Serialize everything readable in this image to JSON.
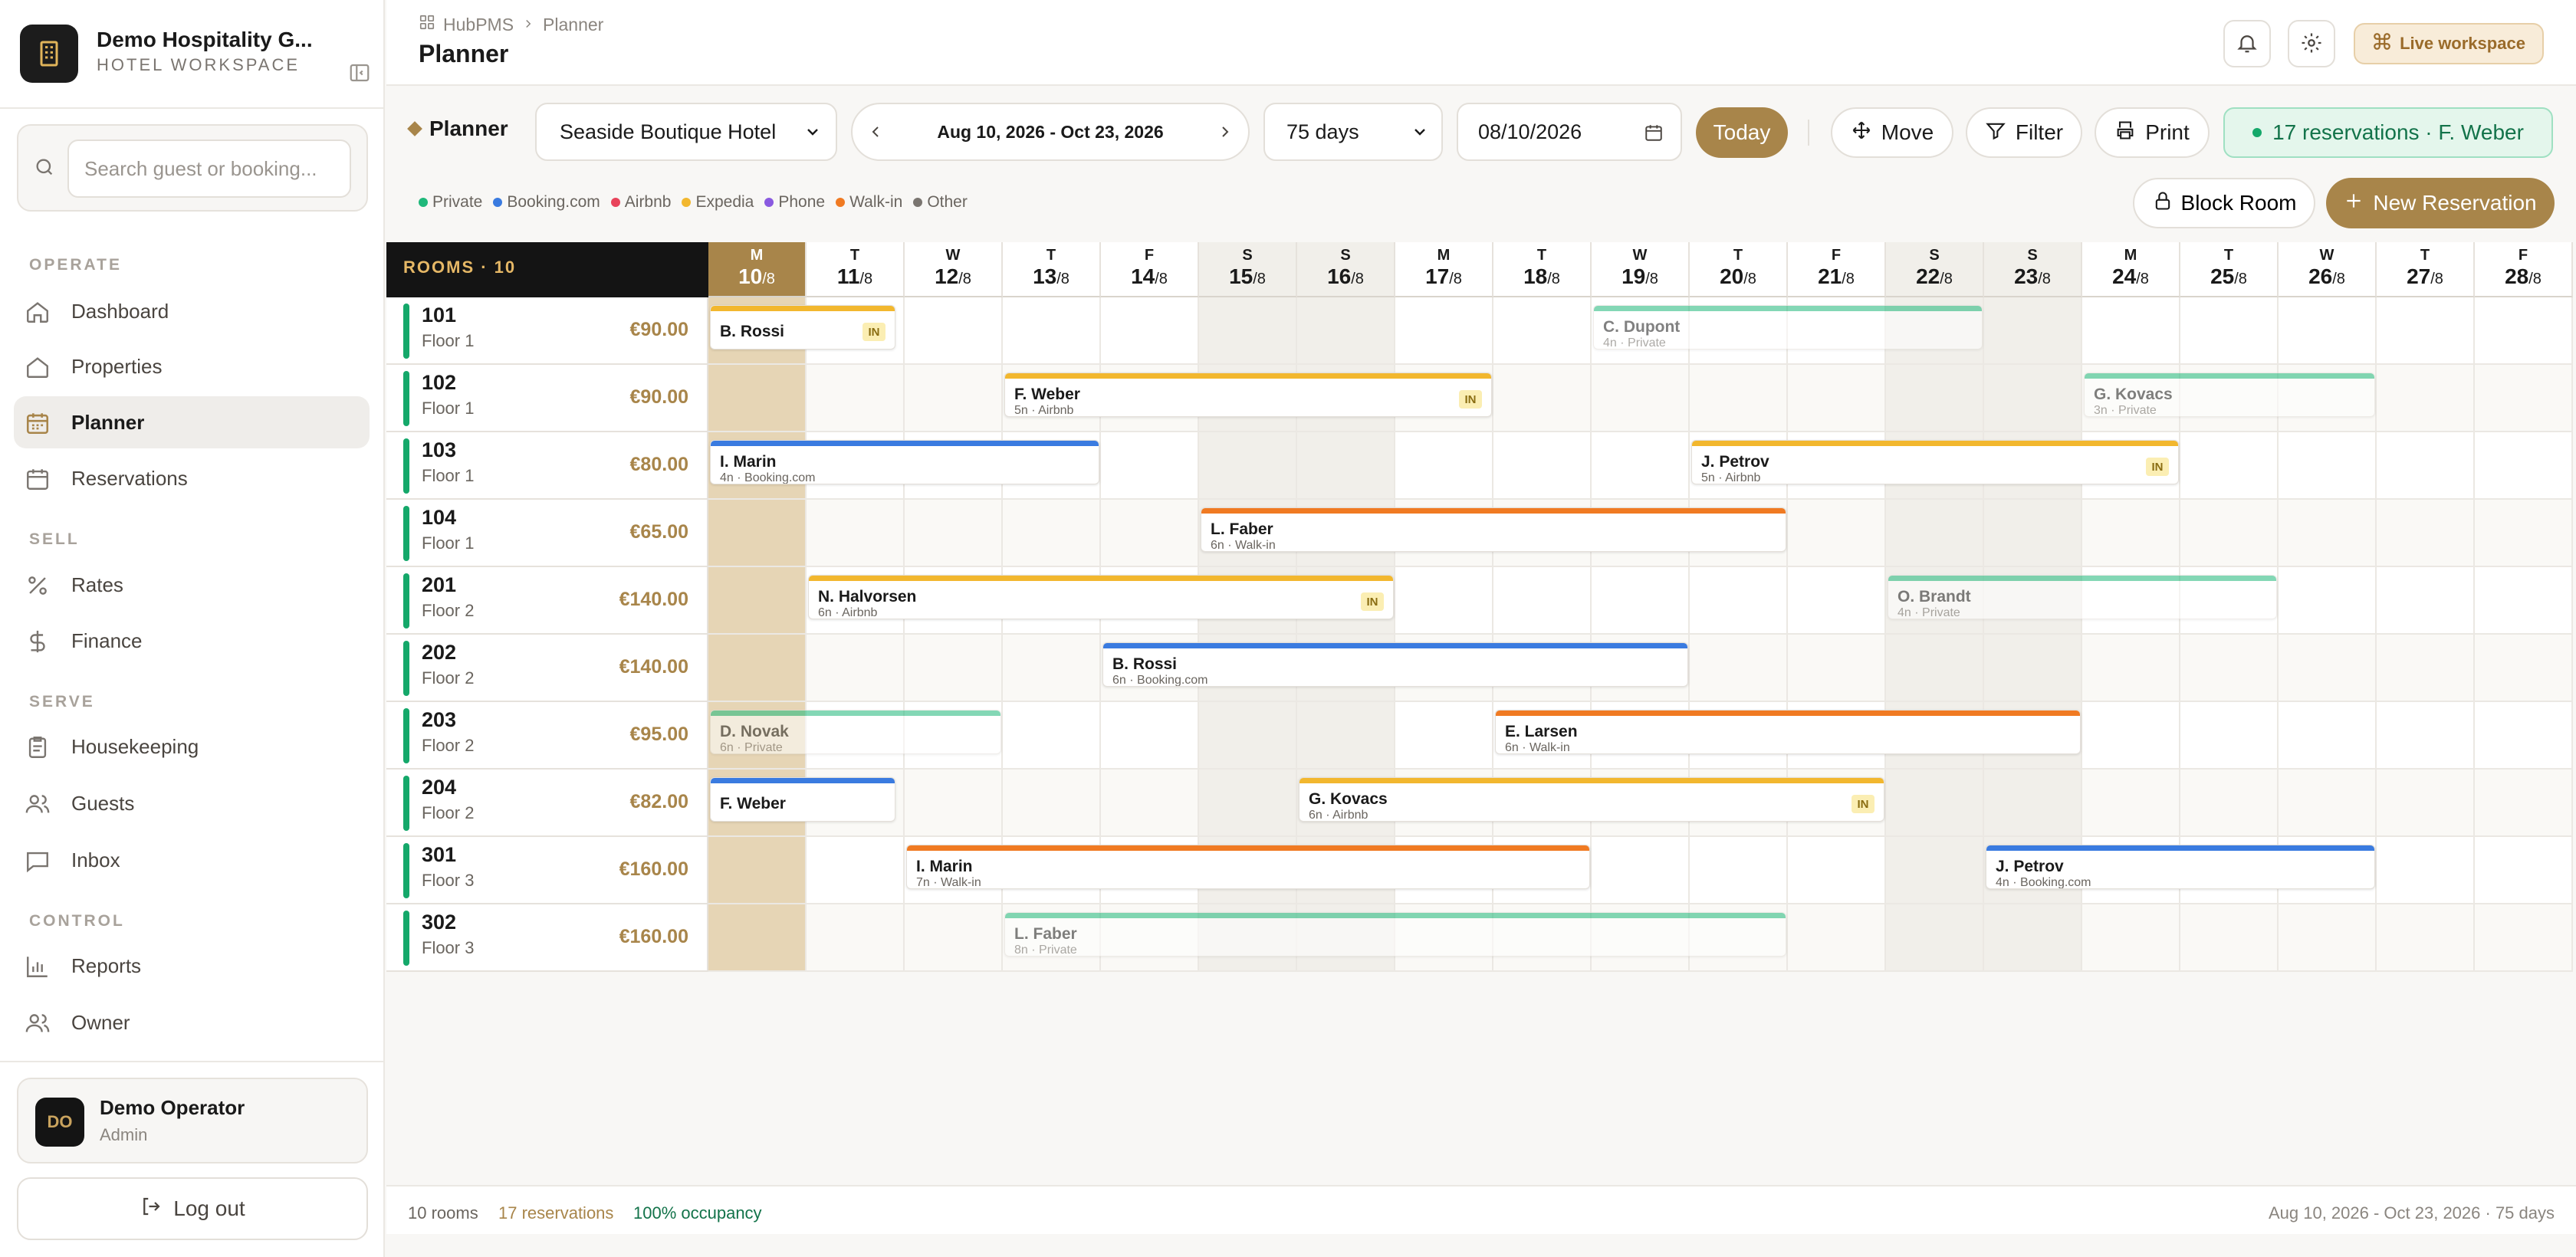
{
  "sidebar": {
    "brand_name": "Demo Hospitality G...",
    "brand_sub": "HOTEL WORKSPACE",
    "search_placeholder": "Search guest or booking...",
    "sections": [
      {
        "label": "OPERATE",
        "items": [
          {
            "label": "Dashboard",
            "icon": "home-icon"
          },
          {
            "label": "Properties",
            "icon": "building-icon"
          },
          {
            "label": "Planner",
            "icon": "calendar-icon",
            "active": true
          },
          {
            "label": "Reservations",
            "icon": "calendar-icon"
          }
        ]
      },
      {
        "label": "SELL",
        "items": [
          {
            "label": "Rates",
            "icon": "percent-icon"
          },
          {
            "label": "Finance",
            "icon": "dollar-icon"
          }
        ]
      },
      {
        "label": "SERVE",
        "items": [
          {
            "label": "Housekeeping",
            "icon": "clipboard-icon"
          },
          {
            "label": "Guests",
            "icon": "users-icon"
          },
          {
            "label": "Inbox",
            "icon": "message-icon"
          }
        ]
      },
      {
        "label": "CONTROL",
        "items": [
          {
            "label": "Reports",
            "icon": "bar-chart-icon"
          },
          {
            "label": "Owner",
            "icon": "users-icon"
          }
        ]
      }
    ],
    "user": {
      "initials": "DO",
      "name": "Demo Operator",
      "role": "Admin"
    },
    "logout_label": "Log out"
  },
  "topbar": {
    "crumb_root": "HubPMS",
    "crumb_current": "Planner",
    "title": "Planner",
    "live_label": "Live workspace"
  },
  "toolbar": {
    "title": "Planner",
    "hotel": "Seaside Boutique Hotel",
    "range": "Aug 10, 2026 - Oct 23, 2026",
    "span": "75 days",
    "date": "08/10/2026",
    "today": "Today",
    "move": "Move",
    "filter": "Filter",
    "print": "Print",
    "badge": "17 reservations · F. Weber",
    "block_room": "Block Room",
    "new_reservation": "New Reservation"
  },
  "legend": [
    {
      "label": "Private",
      "color": "#1fb87a"
    },
    {
      "label": "Booking.com",
      "color": "#3a7be0"
    },
    {
      "label": "Airbnb",
      "color": "#e8435a"
    },
    {
      "label": "Expedia",
      "color": "#f2b72e"
    },
    {
      "label": "Phone",
      "color": "#8a5ae0"
    },
    {
      "label": "Walk-in",
      "color": "#f07a22"
    },
    {
      "label": "Other",
      "color": "#7a7570"
    }
  ],
  "grid": {
    "rooms_header": "ROOMS · 10",
    "days": [
      {
        "dow": "M",
        "day": "10",
        "month": "/8",
        "today": true
      },
      {
        "dow": "T",
        "day": "11",
        "month": "/8"
      },
      {
        "dow": "W",
        "day": "12",
        "month": "/8"
      },
      {
        "dow": "T",
        "day": "13",
        "month": "/8"
      },
      {
        "dow": "F",
        "day": "14",
        "month": "/8"
      },
      {
        "dow": "S",
        "day": "15",
        "month": "/8",
        "weekend": true
      },
      {
        "dow": "S",
        "day": "16",
        "month": "/8",
        "weekend": true
      },
      {
        "dow": "M",
        "day": "17",
        "month": "/8"
      },
      {
        "dow": "T",
        "day": "18",
        "month": "/8"
      },
      {
        "dow": "W",
        "day": "19",
        "month": "/8"
      },
      {
        "dow": "T",
        "day": "20",
        "month": "/8"
      },
      {
        "dow": "F",
        "day": "21",
        "month": "/8"
      },
      {
        "dow": "S",
        "day": "22",
        "month": "/8",
        "weekend": true
      },
      {
        "dow": "S",
        "day": "23",
        "month": "/8",
        "weekend": true
      },
      {
        "dow": "M",
        "day": "24",
        "month": "/8"
      },
      {
        "dow": "T",
        "day": "25",
        "month": "/8"
      },
      {
        "dow": "W",
        "day": "26",
        "month": "/8"
      },
      {
        "dow": "T",
        "day": "27",
        "month": "/8"
      },
      {
        "dow": "F",
        "day": "28",
        "month": "/8"
      }
    ],
    "rooms": [
      {
        "number": "101",
        "floor": "Floor 1",
        "price": "€90.00"
      },
      {
        "number": "102",
        "floor": "Floor 1",
        "price": "€90.00"
      },
      {
        "number": "103",
        "floor": "Floor 1",
        "price": "€80.00"
      },
      {
        "number": "104",
        "floor": "Floor 1",
        "price": "€65.00"
      },
      {
        "number": "201",
        "floor": "Floor 2",
        "price": "€140.00"
      },
      {
        "number": "202",
        "floor": "Floor 2",
        "price": "€140.00"
      },
      {
        "number": "203",
        "floor": "Floor 2",
        "price": "€95.00"
      },
      {
        "number": "204",
        "floor": "Floor 2",
        "price": "€82.00"
      },
      {
        "number": "301",
        "floor": "Floor 3",
        "price": "€160.00"
      },
      {
        "number": "302",
        "floor": "Floor 3",
        "price": "€160.00"
      }
    ],
    "reservations": [
      {
        "row": 0,
        "start": 0,
        "nights": 2,
        "guest": "B. Rossi",
        "sub": "",
        "color": "#f2b72e",
        "in": "IN"
      },
      {
        "row": 0,
        "start": 9,
        "nights": 4,
        "guest": "C. Dupont",
        "sub": "4n · Private",
        "color": "#1fb87a",
        "faded": true
      },
      {
        "row": 1,
        "start": 3,
        "nights": 5,
        "guest": "F. Weber",
        "sub": "5n · Airbnb",
        "color": "#f2b72e",
        "in": "IN"
      },
      {
        "row": 1,
        "start": 14,
        "nights": 3,
        "guest": "G. Kovacs",
        "sub": "3n · Private",
        "color": "#1fb87a",
        "faded": true
      },
      {
        "row": 2,
        "start": 0,
        "nights": 4,
        "guest": "I. Marin",
        "sub": "4n · Booking.com",
        "color": "#3a7be0"
      },
      {
        "row": 2,
        "start": 10,
        "nights": 5,
        "guest": "J. Petrov",
        "sub": "5n · Airbnb",
        "color": "#f2b72e",
        "in": "IN"
      },
      {
        "row": 3,
        "start": 5,
        "nights": 6,
        "guest": "L. Faber",
        "sub": "6n · Walk-in",
        "color": "#f07a22"
      },
      {
        "row": 4,
        "start": 1,
        "nights": 6,
        "guest": "N. Halvorsen",
        "sub": "6n · Airbnb",
        "color": "#f2b72e",
        "in": "IN"
      },
      {
        "row": 4,
        "start": 12,
        "nights": 4,
        "guest": "O. Brandt",
        "sub": "4n · Private",
        "color": "#1fb87a",
        "faded": true
      },
      {
        "row": 5,
        "start": 4,
        "nights": 6,
        "guest": "B. Rossi",
        "sub": "6n · Booking.com",
        "color": "#3a7be0"
      },
      {
        "row": 6,
        "start": 0,
        "nights": 3,
        "guest": "D. Novak",
        "sub": "6n · Private",
        "color": "#1fb87a",
        "faded": true
      },
      {
        "row": 6,
        "start": 8,
        "nights": 6,
        "guest": "E. Larsen",
        "sub": "6n · Walk-in",
        "color": "#f07a22"
      },
      {
        "row": 7,
        "start": 0,
        "nights": 2,
        "guest": "F. Weber",
        "sub": "",
        "color": "#3a7be0"
      },
      {
        "row": 7,
        "start": 6,
        "nights": 6,
        "guest": "G. Kovacs",
        "sub": "6n · Airbnb",
        "color": "#f2b72e",
        "in": "IN"
      },
      {
        "row": 8,
        "start": 2,
        "nights": 7,
        "guest": "I. Marin",
        "sub": "7n · Walk-in",
        "color": "#f07a22"
      },
      {
        "row": 8,
        "start": 13,
        "nights": 4,
        "guest": "J. Petrov",
        "sub": "4n · Booking.com",
        "color": "#3a7be0"
      },
      {
        "row": 9,
        "start": 3,
        "nights": 8,
        "guest": "L. Faber",
        "sub": "8n · Private",
        "color": "#1fb87a",
        "faded": true
      }
    ]
  },
  "status": {
    "rooms": "10 rooms",
    "reservations": "17 reservations",
    "occupancy": "100% occupancy",
    "range": "Aug 10, 2026 - Oct 23, 2026 · 75 days"
  }
}
